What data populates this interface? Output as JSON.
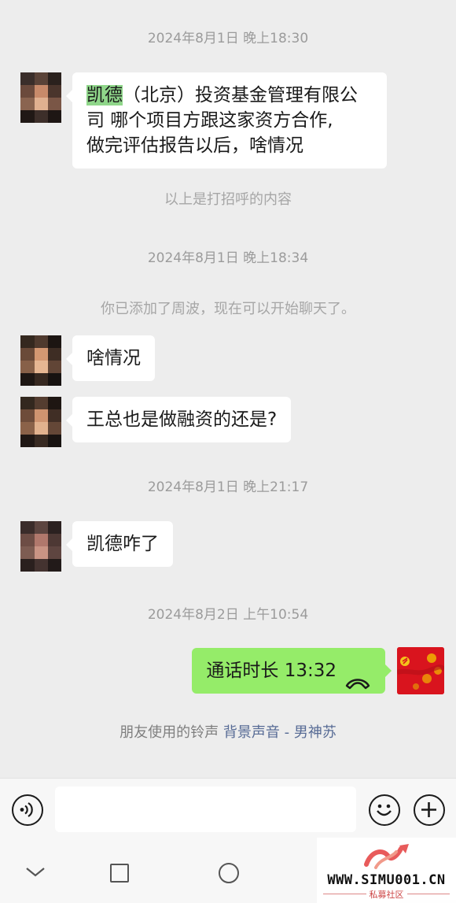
{
  "messages": {
    "t1": "2024年8月1日 晚上18:30",
    "m1_highlight": "凯德",
    "m1_line1_rest": "（北京）投资基金管理有限公",
    "m1_line2": "司 哪个项目方跟这家资方合作,",
    "m1_line3": "做完评估报告以后，啥情况",
    "sys1": "以上是打招呼的内容",
    "t2": "2024年8月1日 晚上18:34",
    "sys2": "你已添加了周波，现在可以开始聊天了。",
    "m2": "啥情况",
    "m3": "王总也是做融资的还是?",
    "t3": "2024年8月1日 晚上21:17",
    "m4": "凯德咋了",
    "t4": "2024年8月2日 上午10:54",
    "call": "通话时长 13:32"
  },
  "ringtone": {
    "prefix": "朋友使用的铃声",
    "link": "背景声音 - 男神苏"
  },
  "watermark": {
    "site": "WWW.SIMU001.CN",
    "sub": "私募社区"
  },
  "icons": {
    "voice": "voice-icon",
    "emoji": "emoji-icon",
    "plus": "plus-icon",
    "phone": "phone-hangup-icon",
    "back": "nav-back-icon",
    "home": "nav-home-icon",
    "recent": "nav-recent-icon"
  },
  "colors": {
    "background": "#ededed",
    "my_bubble": "#95ec69",
    "their_bubble": "#ffffff",
    "link": "#576b95",
    "highlight": "#8fd68a"
  }
}
